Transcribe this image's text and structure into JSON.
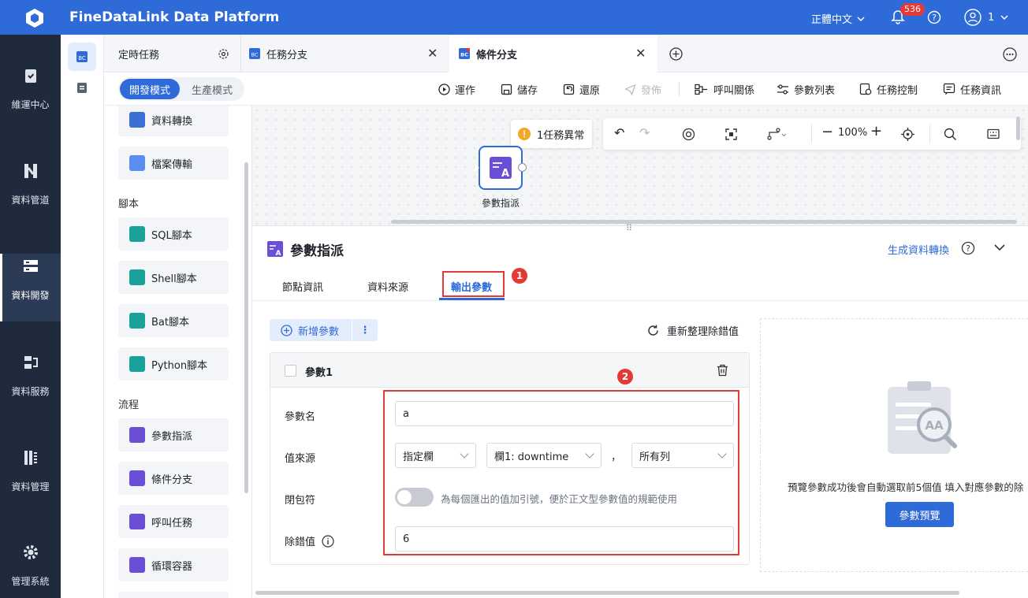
{
  "app": {
    "title": "FineDataLink Data Platform",
    "language": "正體中文",
    "notification_count": "536",
    "user": "1"
  },
  "colors": {
    "brand": "#2f6bd8",
    "nav_bg": "#1f2a3d",
    "warn": "#f5a623",
    "red": "#e53935"
  },
  "nav": [
    {
      "label": "維運中心",
      "icon": "clipboard-check-icon"
    },
    {
      "label": "資料管道",
      "icon": "pipeline-icon"
    },
    {
      "label": "資料開發",
      "icon": "server-icon"
    },
    {
      "label": "資料服務",
      "icon": "service-icon"
    },
    {
      "label": "資料管理",
      "icon": "data-manage-icon"
    },
    {
      "label": "管理系統",
      "icon": "gear-icon"
    }
  ],
  "tabs": {
    "scheduled": "定時任務",
    "tab1": "任務分支",
    "tab2": "條件分支"
  },
  "mode": {
    "dev": "開發模式",
    "prod": "生產模式"
  },
  "toolbar": {
    "run": "運作",
    "save": "儲存",
    "restore": "還原",
    "publish": "發佈",
    "call_relation": "呼叫關係",
    "param_list": "參數列表",
    "task_control": "任務控制",
    "task_info": "任務資訊"
  },
  "palette": {
    "item_transform": "資料轉換",
    "item_file": "檔案傳輸",
    "section_script": "腳本",
    "sql": "SQL腳本",
    "shell": "Shell腳本",
    "bat": "Bat腳本",
    "python": "Python腳本",
    "section_flow": "流程",
    "param_assign": "參數指派",
    "cond_branch": "條件分支",
    "call_task": "呼叫任務",
    "loop": "循環容器"
  },
  "canvas": {
    "warning": "1任務異常",
    "zoom": "100%",
    "node_label": "參數指派"
  },
  "panel": {
    "title": "參數指派",
    "gen_link": "生成資料轉換",
    "tabs": [
      "節點資訊",
      "資料來源",
      "輸出參數"
    ],
    "add_param": "新增參數",
    "more": "⋮",
    "refresh": "重新整理除錯值",
    "param_name_title": "參數1",
    "label_name": "參數名",
    "value_name": "a",
    "label_source": "值來源",
    "source_type": "指定欄",
    "source_col": "欄1: downtime",
    "comma": "，",
    "source_rows": "所有列",
    "label_wrap": "閉包符",
    "wrap_hint": "為每個匯出的值加引號，便於正文型參數值的規範使用",
    "wrap_enabled": false,
    "label_debug": "除錯值",
    "debug_value": "6",
    "preview_hint": "預覽參數成功後會自動選取前5個值 填入對應參數的除",
    "preview_btn": "參數預覽",
    "annot_1": "1",
    "annot_2": "2"
  }
}
